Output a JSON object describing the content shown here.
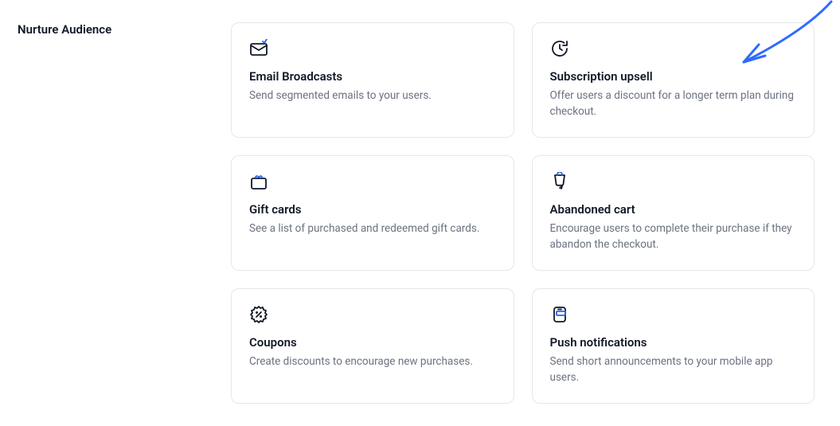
{
  "section": {
    "title": "Nurture Audience"
  },
  "cards": [
    {
      "id": "email-broadcasts",
      "icon": "email-broadcast-icon",
      "title": "Email Broadcasts",
      "desc": "Send segmented emails to your users."
    },
    {
      "id": "subscription-upsell",
      "icon": "clock-arrow-icon",
      "title": "Subscription upsell",
      "desc": "Offer users a discount for a longer term plan during checkout."
    },
    {
      "id": "gift-cards",
      "icon": "gift-card-icon",
      "title": "Gift cards",
      "desc": "See a list of purchased and redeemed gift cards."
    },
    {
      "id": "abandoned-cart",
      "icon": "abandoned-cart-icon",
      "title": "Abandoned cart",
      "desc": "Encourage users to complete their purchase if they abandon the checkout."
    },
    {
      "id": "coupons",
      "icon": "coupon-icon",
      "title": "Coupons",
      "desc": "Create discounts to encourage new purchases."
    },
    {
      "id": "push-notifications",
      "icon": "push-notification-icon",
      "title": "Push notifications",
      "desc": "Send short announcements to your mobile app users."
    }
  ],
  "annotation": {
    "arrow_color": "#2f6bff"
  }
}
